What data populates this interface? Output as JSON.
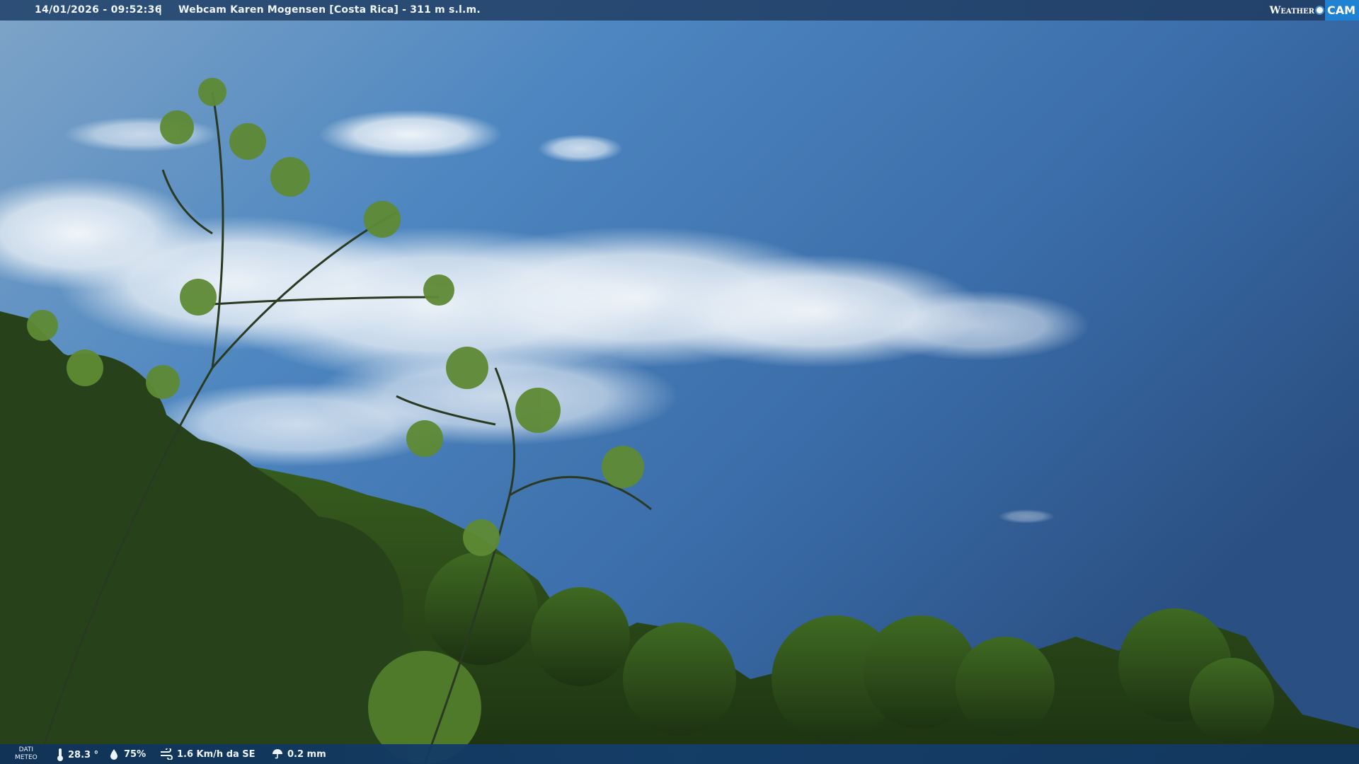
{
  "header": {
    "timestamp": "14/01/2026 - 09:52:36",
    "separator": "|",
    "camera_title": "Webcam Karen Mogensen [Costa Rica] - 311 m s.l.m."
  },
  "brand": {
    "weather": "Weather",
    "cam": "CAM",
    "accent_color": "#1f82d2"
  },
  "footer": {
    "label_line1": "DATI",
    "label_line2": "METEO",
    "temperature": "28.3 °",
    "temperature_icon": "thermometer-icon",
    "humidity": "75%",
    "humidity_icon": "humidity-drop-icon",
    "wind": "1.6 Km/h da SE",
    "wind_icon": "wind-icon",
    "rain": "0.2 mm",
    "rain_icon": "rain-umbrella-icon"
  },
  "scene": {
    "sky_color": "#3d78b6",
    "foliage_color": "#2c4a1c"
  }
}
